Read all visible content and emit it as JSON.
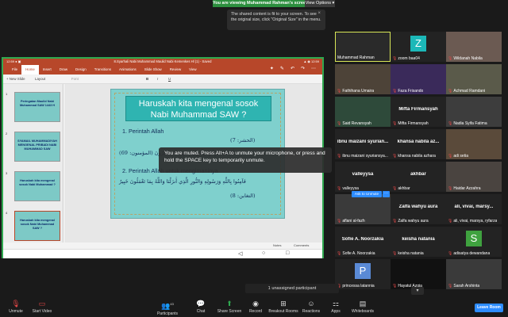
{
  "banner": {
    "viewing": "You are viewing Muhammad Rahman's screen",
    "view_options": "View Options ▾"
  },
  "tooltip": {
    "text": "The shared content is fit to your screen. To see the original size, click \"Original Size\" in the menu.",
    "close": "×"
  },
  "ppt": {
    "status_left": "12:59 ● ▣",
    "doc_title": "8.Syarhali Nabi Muhammad Maulid Nabi Kemenkes Hl (1) - Saved",
    "tabs": [
      "File",
      "Home",
      "Insert",
      "Draw",
      "Design",
      "Transitions",
      "Animations",
      "Slide Show",
      "Review",
      "View"
    ],
    "active_tab": "Home",
    "ribbon": {
      "new_slide": "+ New Slide",
      "layout": "Layout",
      "font": "Font",
      "bold": "B",
      "italic": "I",
      "underline": "U"
    },
    "thumbs": [
      {
        "num": "1",
        "text": "Peringatan Maulid Nabi Muhammad SAW 1443 H"
      },
      {
        "num": "2",
        "text": "SYAMAIL MUHAMMADIYAH MENGENAL PRIBADI NABI MUHAMMAD SAW"
      },
      {
        "num": "3",
        "text": "Haruskah kita mengenal sosok Nabi Muhammad ?"
      },
      {
        "num": "4",
        "text": "Haruskah kita mengenal sosok Nabi Muhammad SAW ?"
      }
    ],
    "slide": {
      "title1": "Haruskah kita mengenal sosok",
      "title2": "Nabi Muhammad SAW ?",
      "point1": "1. Perintah Allah",
      "arabic1a": "(7 :الحشر)",
      "arabic1b": "أَمْ لَمْ يَعْرِفُوا رَسُولَهُمْ فَهُمْ لَهُ مُنكِرُونَ (المؤمنون: 69)",
      "point2": "2. Perintah Allah untuk mengimaninya",
      "arabic2a": "فَآمِنُوا بِاللَّهِ وَرَسُولِهِ وَالنُّورِ الَّذِي أَنزَلْنَا وَاللَّهُ بِمَا تَعْمَلُونَ خَبِيرٌ",
      "arabic2b": "(التغابن: 8)"
    },
    "bottom": {
      "notes": "Notes",
      "comments": "Comments"
    },
    "android_nav": [
      "◁",
      "○",
      "□"
    ],
    "status_right": "▲ ◉ 12:59"
  },
  "muted_notice": "You are muted. Press Alt+A to unmute your microphone, or press and hold the SPACE key to temporarily unmute.",
  "participants": [
    {
      "name": "Muhammad Rahman",
      "label": "",
      "muted": false,
      "speaking": true,
      "avatar": "",
      "bg": "#2a2a2a"
    },
    {
      "name": "zoom baa04",
      "label": "",
      "muted": true,
      "avatar": "Z",
      "bg": "#232323",
      "avatar_bg": "#1cb8b8"
    },
    {
      "name": "Wildanah Nabila",
      "label": "",
      "muted": true,
      "avatar": "",
      "bg": "#6b5a52"
    },
    {
      "name": "Fathihana Umaira",
      "label": "",
      "muted": true,
      "avatar": "",
      "bg": "#4d4338"
    },
    {
      "name": "Faza Frisando",
      "label": "",
      "muted": true,
      "avatar": "",
      "bg": "#3a2a5a"
    },
    {
      "name": "Achmad Ramdani",
      "label": "",
      "muted": true,
      "avatar": "",
      "bg": "#5a5a4a"
    },
    {
      "name": "Said Revansyah",
      "label": "",
      "muted": true,
      "avatar": "",
      "bg": "#2e4a3a"
    },
    {
      "name": "Mifta Firmansyah",
      "label": "Mifta Firmansyah",
      "muted": true,
      "avatar": "",
      "bg": "#232323"
    },
    {
      "name": "Nadia Syifa Fatima",
      "label": "",
      "muted": true,
      "avatar": "",
      "bg": "#3d3d3d"
    },
    {
      "name": "ibnu maizani syuriansya...",
      "label": "ibnu maizani syurian...",
      "muted": true,
      "avatar": "",
      "bg": "#232323"
    },
    {
      "name": "khansa nabila azhara",
      "label": "khansa nabila az...",
      "muted": true,
      "avatar": "",
      "bg": "#232323"
    },
    {
      "name": "adi setia",
      "label": "",
      "muted": true,
      "avatar": "",
      "bg": "#5a4a3a"
    },
    {
      "name": "valleyysa",
      "label": "valleyysa",
      "muted": true,
      "avatar": "",
      "bg": "#232323"
    },
    {
      "name": "akhbar",
      "label": "akhbar",
      "muted": true,
      "avatar": "",
      "bg": "#232323"
    },
    {
      "name": "Haidar Azzahra",
      "label": "",
      "muted": true,
      "avatar": "",
      "bg": "#4a4440"
    },
    {
      "name": "aflani al-fazh",
      "label": "",
      "muted": true,
      "avatar": "",
      "bg": "#3a3a3a"
    },
    {
      "name": "Zalfa wahyu aura",
      "label": "Zalfa wahyu aura",
      "muted": true,
      "avatar": "",
      "bg": "#232323"
    },
    {
      "name": "ali, vivai, marsya, ryfarza",
      "label": "ali, vivai, marsy...",
      "muted": true,
      "avatar": "",
      "bg": "#232323"
    },
    {
      "name": "Sofie A. Noorzakia",
      "label": "Sofie A. Noorzakia",
      "muted": true,
      "avatar": "",
      "bg": "#232323"
    },
    {
      "name": "keisha natania",
      "label": "keisha natania",
      "muted": true,
      "avatar": "",
      "bg": "#232323"
    },
    {
      "name": "adisatya dewandana",
      "label": "",
      "muted": true,
      "avatar": "S",
      "bg": "#232323",
      "avatar_bg": "#3fa23f"
    },
    {
      "name": "princessa latannia",
      "label": "",
      "muted": true,
      "avatar": "P",
      "bg": "#232323",
      "avatar_bg": "#5a8ad6"
    },
    {
      "name": "Hayatul Azqia",
      "label": "",
      "muted": true,
      "avatar": "",
      "bg": "#111111"
    },
    {
      "name": "Sarah Arshinta",
      "label": "",
      "muted": true,
      "avatar": "",
      "bg": "#3a3a3a"
    }
  ],
  "ask_to_unmute": "Ask to Unmute",
  "ask_more": "···",
  "unassigned": "1 unassigned participant",
  "controls": {
    "unmute": "Unmute",
    "start_video": "Start Video",
    "participants": "Participants",
    "participants_count": "43",
    "chat": "Chat",
    "share_screen": "Share Screen",
    "record": "Record",
    "breakout": "Breakout Rooms",
    "reactions": "Reactions",
    "apps": "Apps",
    "whiteboards": "Whiteboards",
    "leave": "Leave Room"
  },
  "colors": {
    "accent": "#2d8cff",
    "share_border": "#2fa84f",
    "ppt_red": "#b7472a",
    "slide_bg": "#7fd0cd",
    "speaking": "#d8e657",
    "muted_red": "#e04747"
  }
}
